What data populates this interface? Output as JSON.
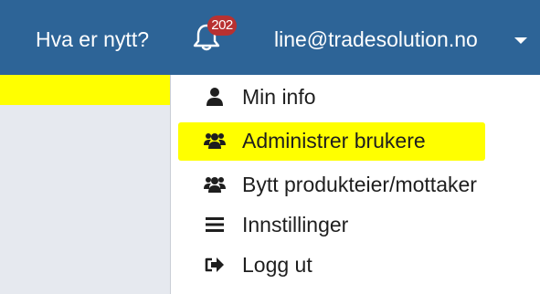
{
  "navbar": {
    "whats_new": "Hva er nytt?",
    "notification_count": "202",
    "user_email": "line@tradesolution.no",
    "bg_color": "#2d6497"
  },
  "menu": {
    "items": [
      {
        "label": "Min info",
        "icon": "user-icon"
      },
      {
        "label": "Administrer brukere",
        "icon": "users-icon",
        "highlighted": true
      },
      {
        "label": "Bytt produkteier/mottaker",
        "icon": "users-icon"
      },
      {
        "label": "Innstillinger",
        "icon": "hamburger-icon"
      },
      {
        "label": "Logg ut",
        "icon": "sign-out-icon"
      }
    ]
  },
  "colors": {
    "highlight": "#ffff00",
    "badge": "#b83131",
    "sidebar": "#e6e9ef"
  }
}
